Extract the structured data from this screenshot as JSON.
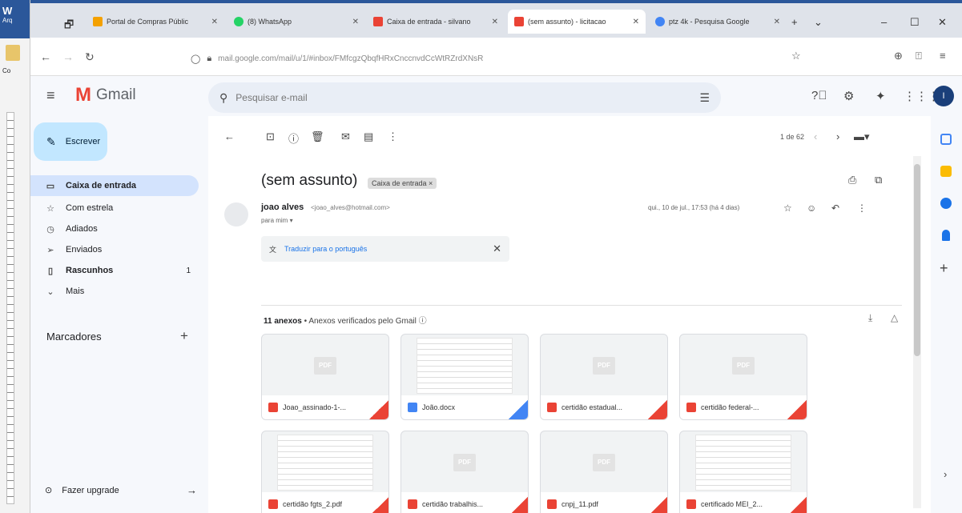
{
  "word": {
    "app_abbr": "Arq",
    "label": "Co"
  },
  "browser": {
    "tabs": [
      {
        "title": "Portal de Compras Públic",
        "color": "#f4a100"
      },
      {
        "title": "(8) WhatsApp",
        "color": "#25d366"
      },
      {
        "title": "Caixa de entrada - silvano",
        "color": "#ea4335"
      },
      {
        "title": "(sem assunto) - licitacao",
        "color": "#ea4335"
      },
      {
        "title": "ptz 4k - Pesquisa Google",
        "color": "#4285f4"
      }
    ],
    "url": "mail.google.com/mail/u/1/#inbox/FMfcgzQbqfHRxCnccnvdCcWtRZrdXNsR",
    "url_host": "mail.google.com"
  },
  "gmail": {
    "brand": "Gmail",
    "search_placeholder": "Pesquisar e-mail",
    "compose": "Escrever",
    "nav": [
      {
        "label": "Caixa de entrada",
        "icon": "inbox-icon",
        "glyph": "▭",
        "active": true,
        "bold": true,
        "count": ""
      },
      {
        "label": "Com estrela",
        "icon": "star-icon",
        "glyph": "☆",
        "active": false,
        "bold": false,
        "count": ""
      },
      {
        "label": "Adiados",
        "icon": "clock-icon",
        "glyph": "◷",
        "active": false,
        "bold": false,
        "count": ""
      },
      {
        "label": "Enviados",
        "icon": "send-icon",
        "glyph": "➢",
        "active": false,
        "bold": false,
        "count": ""
      },
      {
        "label": "Rascunhos",
        "icon": "draft-icon",
        "glyph": "▯",
        "active": false,
        "bold": true,
        "count": "1"
      },
      {
        "label": "Mais",
        "icon": "chevron-down-icon",
        "glyph": "⌄",
        "active": false,
        "bold": false,
        "count": ""
      }
    ],
    "labels_heading": "Marcadores",
    "upgrade": "Fazer upgrade",
    "pager": "1 de 62",
    "message": {
      "subject": "(sem assunto)",
      "label_chip": "Caixa de entrada ×",
      "sender_name": "joao alves",
      "sender_email": "<joao_alves@hotmail.com>",
      "to": "para mim ▾",
      "date": "qui., 10 de jul., 17:53 (há 4 dias)",
      "translate": "Traduzir para o português"
    },
    "attachments": {
      "count_label": "11 anexos",
      "verified": " •  Anexos verificados pelo Gmail ⓘ",
      "items": [
        {
          "name": "Joao_assinado-1-...",
          "type": "pdf",
          "icon_color": "#ea4335"
        },
        {
          "name": "João.docx",
          "type": "doc",
          "icon_color": "#4285f4"
        },
        {
          "name": "certidão estadual...",
          "type": "pdf",
          "icon_color": "#ea4335"
        },
        {
          "name": "certidão federal-...",
          "type": "pdf",
          "icon_color": "#ea4335"
        },
        {
          "name": "certidão fgts_2.pdf",
          "type": "doc",
          "icon_color": "#ea4335"
        },
        {
          "name": "certidão trabalhis...",
          "type": "pdf",
          "icon_color": "#ea4335"
        },
        {
          "name": "cnpj_11.pdf",
          "type": "pdf",
          "icon_color": "#ea4335"
        },
        {
          "name": "certificado MEI_2...",
          "type": "doc",
          "icon_color": "#ea4335"
        }
      ]
    }
  }
}
